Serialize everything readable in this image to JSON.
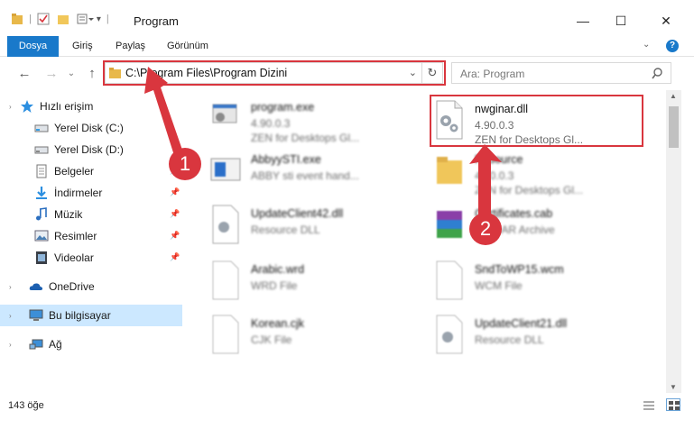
{
  "window": {
    "title": "Program",
    "minimize": "—",
    "maximize": "☐",
    "close": "✕"
  },
  "ribbon": {
    "tabs": [
      "Dosya",
      "Giriş",
      "Paylaş",
      "Görünüm"
    ],
    "accent": "#1979ca"
  },
  "address_bar": {
    "path": "C:\\Program Files\\Program Dizini",
    "search_placeholder": "Ara: Program"
  },
  "sidebar": {
    "items": [
      {
        "label": "Hızlı erişim",
        "icon": "star-icon"
      },
      {
        "label": "Yerel Disk (C:)",
        "icon": "drive-icon"
      },
      {
        "label": "Yerel Disk (D:)",
        "icon": "drive-icon"
      },
      {
        "label": "Belgeler",
        "icon": "documents-icon"
      },
      {
        "label": "İndirmeler",
        "icon": "download-icon"
      },
      {
        "label": "Müzik",
        "icon": "music-icon"
      },
      {
        "label": "Resimler",
        "icon": "pictures-icon"
      },
      {
        "label": "Videolar",
        "icon": "video-icon"
      },
      {
        "label": "OneDrive",
        "icon": "cloud-icon"
      },
      {
        "label": "Bu bilgisayar",
        "icon": "computer-icon"
      },
      {
        "label": "Ağ",
        "icon": "network-icon"
      }
    ]
  },
  "files": [
    {
      "name": "program.exe",
      "line2": "4.90.0.3",
      "line3": "ZEN for Desktops Gl..."
    },
    {
      "name": "nwginar.dll",
      "line2": "4.90.0.3",
      "line3": "ZEN for Desktops Gl..."
    },
    {
      "name": "AbbyySTI.exe",
      "line2": "ABBY sti event hand..."
    },
    {
      "name": "Resource",
      "line2": "4.90.0.3",
      "line3": "ZEN for Desktops Gl..."
    },
    {
      "name": "UpdateClient42.dll",
      "line2": "Resource DLL"
    },
    {
      "name": "Certificates.cab",
      "line2": "WinRAR Archive"
    },
    {
      "name": "Arabic.wrd",
      "line2": "WRD File"
    },
    {
      "name": "SndToWP15.wcm",
      "line2": "WCM File"
    },
    {
      "name": "Korean.cjk",
      "line2": "CJK File"
    },
    {
      "name": "UpdateClient21.dll",
      "line2": "Resource DLL"
    }
  ],
  "status": {
    "count": "143 öğe"
  },
  "annotations": {
    "step1": "1",
    "step2": "2",
    "color": "#d9363e"
  }
}
